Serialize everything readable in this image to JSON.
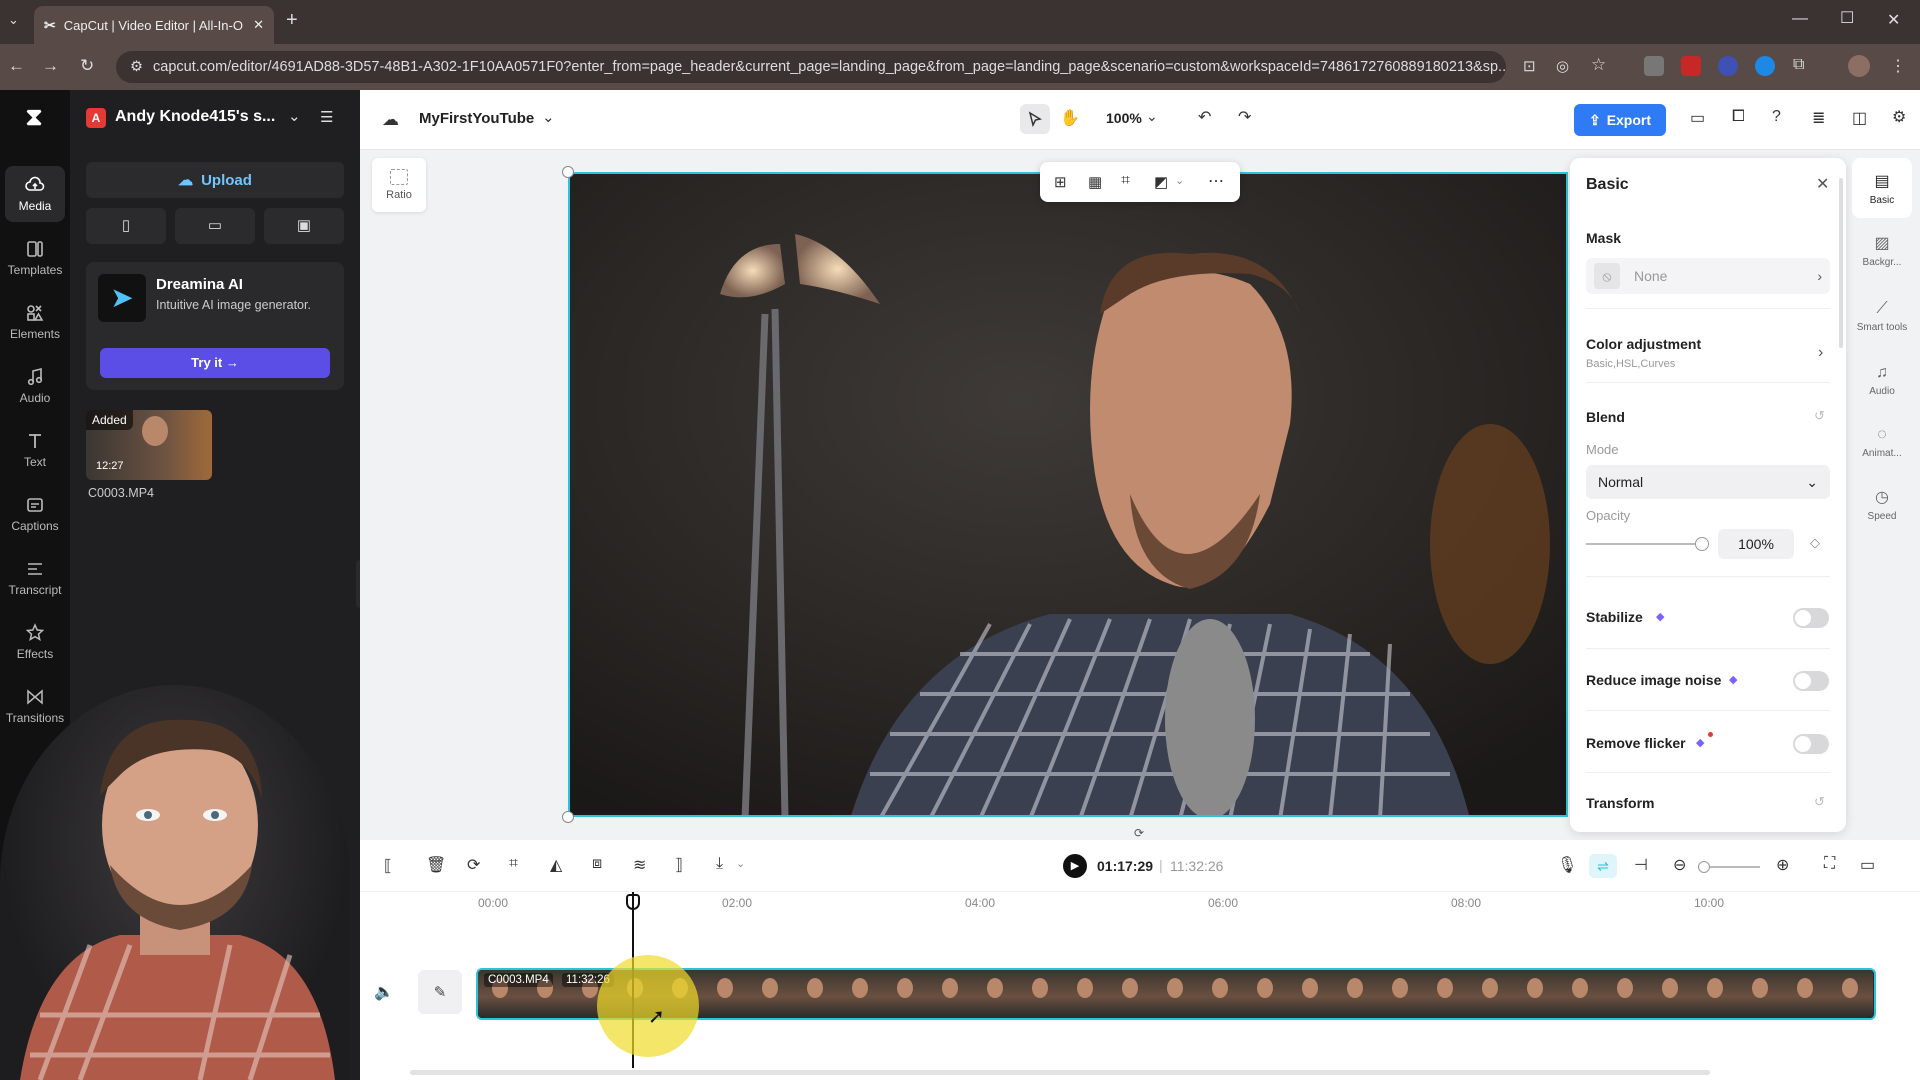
{
  "browser": {
    "tab_title": "CapCut | Video Editor | All-In-O",
    "url": "capcut.com/editor/4691AD88-3D57-48B1-A302-1F10AA0571F0?enter_from=page_header&current_page=landing_page&from_page=landing_page&scenario=custom&workspaceId=7486172760889180213&sp..."
  },
  "rail": {
    "items": [
      {
        "label": "Media",
        "icon": "cloud-upload-icon"
      },
      {
        "label": "Templates",
        "icon": "templates-icon"
      },
      {
        "label": "Elements",
        "icon": "elements-icon"
      },
      {
        "label": "Audio",
        "icon": "music-note-icon"
      },
      {
        "label": "Text",
        "icon": "text-icon"
      },
      {
        "label": "Captions",
        "icon": "captions-icon"
      },
      {
        "label": "Transcript",
        "icon": "transcript-icon"
      },
      {
        "label": "Effects",
        "icon": "effects-icon"
      },
      {
        "label": "Transitions",
        "icon": "transitions-icon"
      }
    ]
  },
  "panel": {
    "workspace_initial": "A",
    "workspace_name": "Andy Knode415's s...",
    "upload_label": "Upload",
    "promo_title": "Dreamina AI",
    "promo_desc": "Intuitive AI image generator.",
    "promo_cta": "Try it →",
    "media_badge": "Added",
    "media_duration": "12:27",
    "media_name": "C0003.MP4"
  },
  "topbar": {
    "project_name": "MyFirstYouTube",
    "zoom": "100%",
    "export_label": "Export"
  },
  "canvas": {
    "ratio_label": "Ratio"
  },
  "props": {
    "title": "Basic",
    "mask_label": "Mask",
    "mask_value": "None",
    "color_adj_label": "Color adjustment",
    "color_adj_sub": "Basic,HSL,Curves",
    "blend_label": "Blend",
    "mode_label": "Mode",
    "mode_value": "Normal",
    "opacity_label": "Opacity",
    "opacity_value": "100%",
    "opacity_fraction": 1.0,
    "stabilize_label": "Stabilize",
    "noise_label": "Reduce image noise",
    "flicker_label": "Remove flicker",
    "transform_label": "Transform"
  },
  "right_tabs": [
    {
      "label": "Basic"
    },
    {
      "label": "Backgr..."
    },
    {
      "label": "Smart tools"
    },
    {
      "label": "Audio"
    },
    {
      "label": "Animat..."
    },
    {
      "label": "Speed"
    }
  ],
  "timeline": {
    "current_time": "01:17:29",
    "total_time": "11:32:26",
    "ticks": [
      "00:00",
      "02:00",
      "04:00",
      "06:00",
      "08:00",
      "10:00"
    ],
    "clip_name": "C0003.MP4",
    "clip_duration": "11:32:26"
  },
  "colors": {
    "accent": "#29c4d9",
    "export": "#2f7bf5",
    "promo_cta": "#5b4ee6"
  }
}
